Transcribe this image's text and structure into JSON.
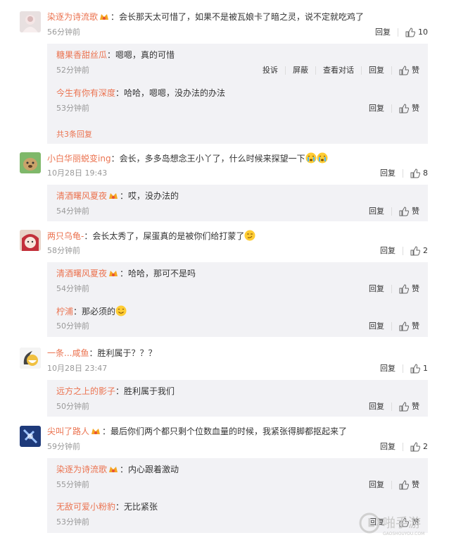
{
  "like_label": "赞",
  "reply_label": "回复",
  "report_label": "投诉",
  "block_label": "屏蔽",
  "view_conv_label": "查看对话",
  "comments": [
    {
      "user": "染逐为诗流歌",
      "text": "：会长那天太可惜了，如果不是被瓦娘卡了暗之灵，说不定就吃鸡了",
      "time": "56分钟前",
      "likes": "10",
      "replies": [
        {
          "user": "糖果香甜丝瓜",
          "text": "：嗯嗯，真的可惜",
          "time": "52分钟前"
        },
        {
          "user": "今生有你有深度",
          "text": "：哈哈，嗯嗯，没办法的办法",
          "time": "53分钟前"
        }
      ],
      "more": "共3条回复"
    },
    {
      "user": "小白华丽蜕变ing",
      "text": "：会长，多多岛想念王小丫了，什么时候来探望一下",
      "time": "10月28日 19:43",
      "likes": "8",
      "replies": [
        {
          "user": "清酒曙风夏夜",
          "text": "：哎，没办法的",
          "time": "54分钟前"
        }
      ]
    },
    {
      "user": "两只乌龟-",
      "text": "：会长太秀了，屎蛋真的是被你们给打蒙了",
      "time": "58分钟前",
      "likes": "2",
      "replies": [
        {
          "user": "清酒曙风夏夜",
          "text": "：哈哈，那可不是吗",
          "time": "54分钟前"
        },
        {
          "user": "柠浦",
          "text": "：那必须的",
          "time": "50分钟前"
        }
      ]
    },
    {
      "user": "一条...咸鱼",
      "text": "：胜利属于？？？",
      "time": "10月28日 23:47",
      "likes": "1",
      "replies": [
        {
          "user": "远方之上的影子",
          "text": "：胜利属于我们",
          "time": "50分钟前"
        }
      ]
    },
    {
      "user": "尖叫了路人",
      "text": "：最后你们两个都只剩个位数血量的时候，我紧张得脚都抠起来了",
      "time": "59分钟前",
      "likes": "2",
      "replies": [
        {
          "user": "染逐为诗流歌",
          "text": "：内心跟着激动",
          "time": "55分钟前"
        },
        {
          "user": "无敌可爱小粉豹",
          "text": "：无比紧张",
          "time": "53分钟前"
        }
      ]
    }
  ],
  "watermark": {
    "main": "啪手游",
    "sub": "GAOSHOUYOU.COM"
  },
  "colors": {
    "name": "#eb7350",
    "reply_bg": "#f2f2f5",
    "meta": "#999999"
  }
}
